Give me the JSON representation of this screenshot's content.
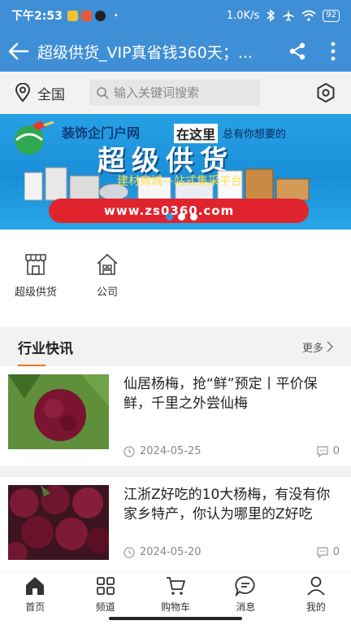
{
  "status": {
    "time": "下午2:53",
    "network": "1.0K/s",
    "battery": "92"
  },
  "header": {
    "title": "超级供货_VIP真省钱360天；..."
  },
  "search": {
    "location": "全国",
    "placeholder": "输入关键词搜索"
  },
  "banner": {
    "brand": "装饰企门户网",
    "slogan_highlight": "在这里",
    "slogan_rest": "总有你想要的",
    "title": "超级供货",
    "subtitle": "建材商城—站式集采平台",
    "url": "www.zs0360.com",
    "slide_count": 3,
    "active_slide": 0
  },
  "quick_links": [
    {
      "label": "超级供货",
      "icon": "store-icon"
    },
    {
      "label": "公司",
      "icon": "company-icon"
    }
  ],
  "news": {
    "heading": "行业快讯",
    "more": "更多",
    "articles": [
      {
        "title": "仙居杨梅，抢“鲜”预定丨平价保鲜，千里之外尝仙梅",
        "date": "2024-05-25",
        "comments": "0",
        "image": "bayberry-single"
      },
      {
        "title": "江浙Z好吃的10大杨梅，有没有你家乡特产，你认为哪里的Z好吃",
        "date": "2024-05-20",
        "comments": "0",
        "image": "bayberry-pile"
      }
    ]
  },
  "tabbar": [
    {
      "label": "首页",
      "icon": "home-icon"
    },
    {
      "label": "频道",
      "icon": "grid-icon"
    },
    {
      "label": "购物车",
      "icon": "cart-icon"
    },
    {
      "label": "消息",
      "icon": "message-icon"
    },
    {
      "label": "我的",
      "icon": "user-icon"
    }
  ],
  "colors": {
    "primary": "#3f8fd6",
    "accent": "#e8732a"
  }
}
